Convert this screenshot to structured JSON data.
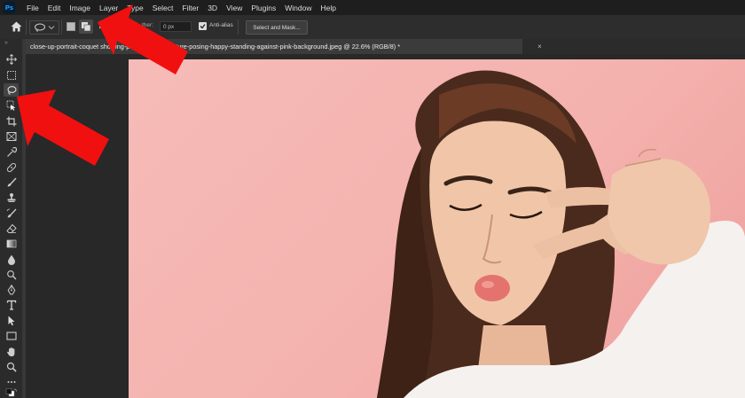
{
  "app": {
    "logo": "Ps"
  },
  "menu": [
    "File",
    "Edit",
    "Image",
    "Layer",
    "Type",
    "Select",
    "Filter",
    "3D",
    "View",
    "Plugins",
    "Window",
    "Help"
  ],
  "options": {
    "feather_label": "ther:",
    "feather_value": "0 px",
    "antialias_checked": true,
    "antialias_label": "Anti-alias",
    "select_mask_label": "Select and Mask..."
  },
  "document": {
    "tab_title": "close-up-portrait-coquet showing-peace-v-sign-gesture-posing-happy-standing-against-pink-background.jpeg @ 22.6% (RGB/8) *",
    "close_glyph": "×"
  },
  "colors": {
    "annotation_arrow": "#f01010",
    "background_pink": "#f4b2ae",
    "panel_dark": "#2b2b2b"
  },
  "tools": [
    "move",
    "marquee",
    "lasso",
    "object-selection",
    "crop",
    "frame",
    "eyedropper",
    "spot-healing",
    "brush",
    "clone-stamp",
    "history-brush",
    "eraser",
    "gradient",
    "blur",
    "dodge",
    "pen",
    "type",
    "path-selection",
    "rectangle",
    "hand",
    "zoom",
    "more"
  ],
  "active_tool": "lasso"
}
